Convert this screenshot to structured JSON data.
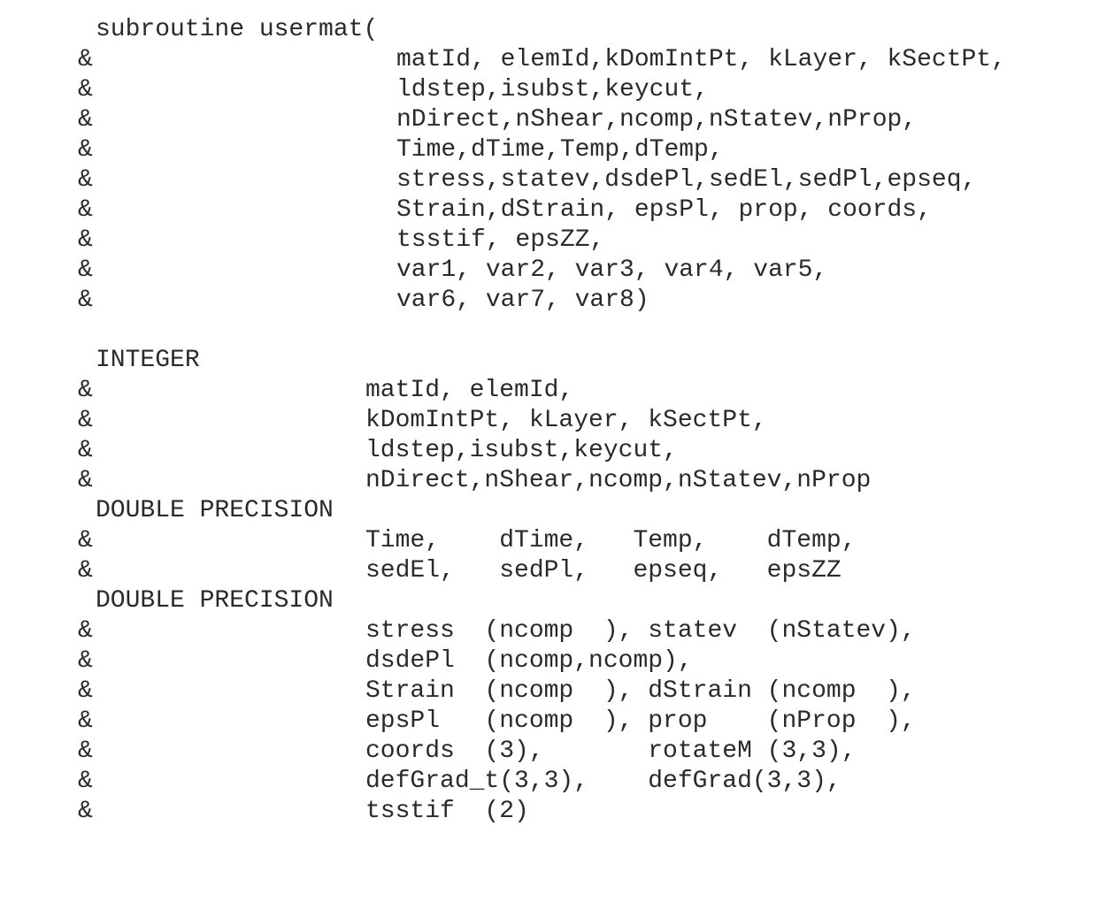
{
  "document": {
    "amp": "&",
    "subroutine_header": "subroutine usermat(",
    "subroutine_args": [
      "matId, elemId,kDomIntPt, kLayer, kSectPt,",
      "ldstep,isubst,keycut,",
      "nDirect,nShear,ncomp,nStatev,nProp,",
      "Time,dTime,Temp,dTemp,",
      "stress,statev,dsdePl,sedEl,sedPl,epseq,",
      "Strain,dStrain, epsPl, prop, coords,",
      "tsstif, epsZZ,",
      "var1, var2, var3, var4, var5,",
      "var6, var7, var8)"
    ],
    "integer_keyword": "INTEGER",
    "integer_lines": [
      "matId, elemId,",
      "kDomIntPt, kLayer, kSectPt,",
      "ldstep,isubst,keycut,",
      "nDirect,nShear,ncomp,nStatev,nProp"
    ],
    "double_keyword_1": "DOUBLE PRECISION",
    "double_lines_1": [
      "Time,    dTime,   Temp,    dTemp,",
      "sedEl,   sedPl,   epseq,   epsZZ"
    ],
    "double_keyword_2": "DOUBLE PRECISION",
    "double_lines_2": [
      "stress  (ncomp  ), statev  (nStatev),",
      "dsdePl  (ncomp,ncomp),",
      "Strain  (ncomp  ), dStrain (ncomp  ),",
      "epsPl   (ncomp  ), prop    (nProp  ),",
      "coords  (3),       rotateM (3,3),",
      "defGrad_t(3,3),    defGrad(3,3),",
      "tsstif  (2)"
    ]
  }
}
